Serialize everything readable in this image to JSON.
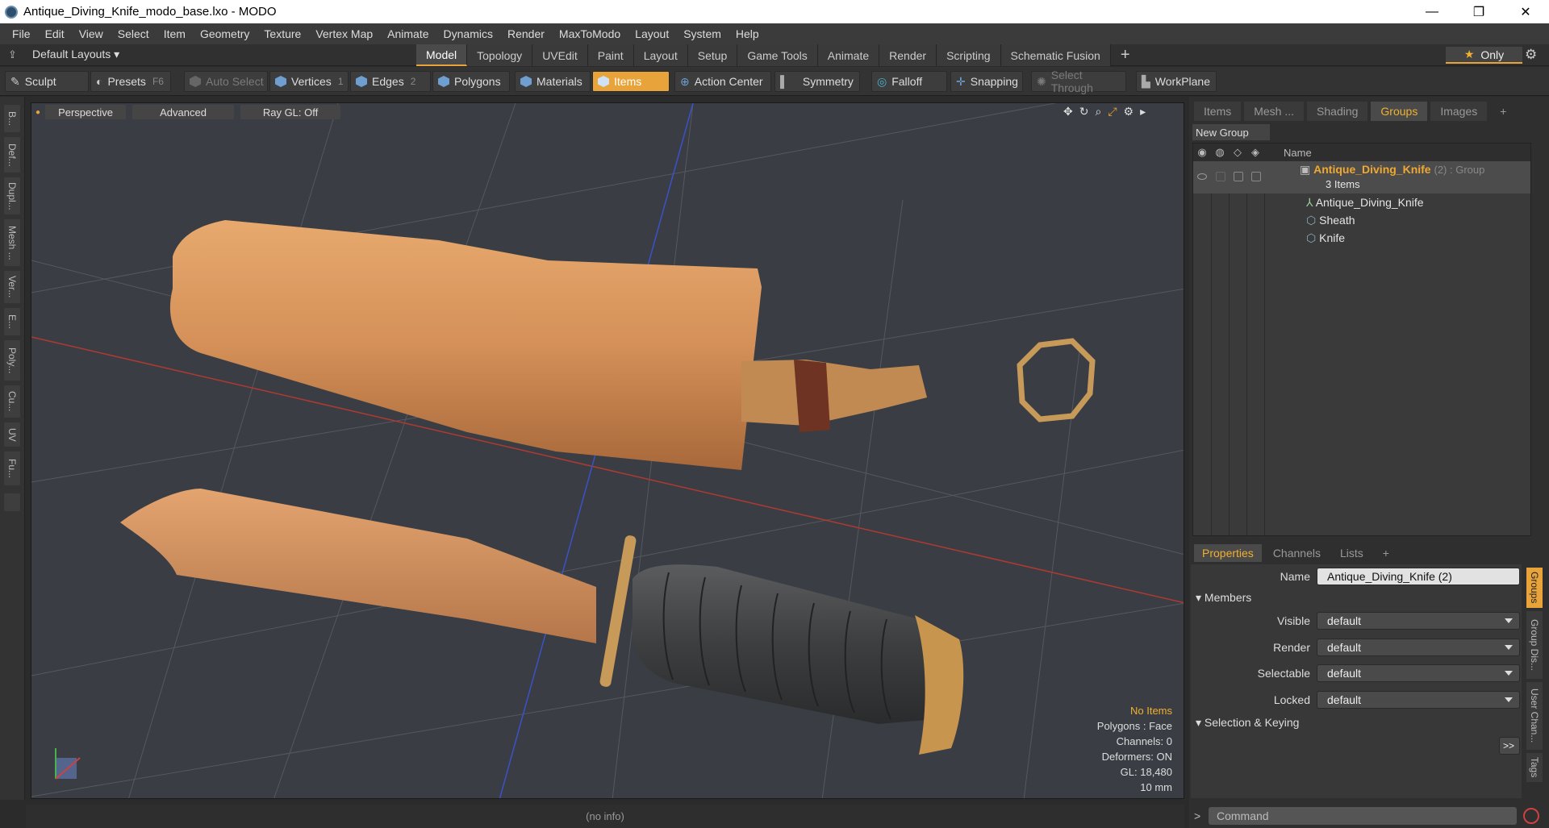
{
  "window": {
    "title": "Antique_Diving_Knife_modo_base.lxo - MODO",
    "minimize": "—",
    "restore": "❐",
    "close": "✕"
  },
  "menu": [
    "File",
    "Edit",
    "View",
    "Select",
    "Item",
    "Geometry",
    "Texture",
    "Vertex Map",
    "Animate",
    "Dynamics",
    "Render",
    "MaxToModo",
    "Layout",
    "System",
    "Help"
  ],
  "layout": {
    "default_layouts": "Default Layouts ▾",
    "tabs": [
      "Model",
      "Topology",
      "UVEdit",
      "Paint",
      "Layout",
      "Setup",
      "Game Tools",
      "Animate",
      "Render",
      "Scripting",
      "Schematic Fusion"
    ],
    "active_tab": "Model",
    "only": "Only"
  },
  "toolbar": {
    "sculpt": "Sculpt",
    "presets": "Presets",
    "presets_key": "F6",
    "auto_select": "Auto Select",
    "vertices": "Vertices",
    "vertices_count": "1",
    "edges": "Edges",
    "edges_count": "2",
    "polygons": "Polygons",
    "materials": "Materials",
    "items": "Items",
    "action_center": "Action Center",
    "symmetry": "Symmetry",
    "falloff": "Falloff",
    "snapping": "Snapping",
    "select_through": "Select Through",
    "workplane": "WorkPlane"
  },
  "left_tabs": [
    "B...",
    "Def...",
    "Dupl...",
    "Mesh ...",
    "Ver...",
    "E...",
    "Poly...",
    "Cu...",
    "UV",
    "Fu..."
  ],
  "viewport": {
    "perspective": "Perspective",
    "advanced": "Advanced",
    "raygl": "Ray GL: Off",
    "info": {
      "no_items": "No Items",
      "polygons": "Polygons : Face",
      "channels": "Channels: 0",
      "deformers": "Deformers: ON",
      "gl": "GL: 18,480",
      "units": "10 mm"
    }
  },
  "status": "(no info)",
  "right_tabs": [
    "Items",
    "Mesh ...",
    "Shading",
    "Groups",
    "Images"
  ],
  "right_active_tab": "Groups",
  "groups": {
    "new_group": "New Group",
    "col_name": "Name",
    "group_name": "Antique_Diving_Knife",
    "group_suffix": "(2) : Group",
    "group_count": "3 Items",
    "members": [
      "Antique_Diving_Knife",
      "Sheath",
      "Knife"
    ]
  },
  "props_tabs": [
    "Properties",
    "Channels",
    "Lists"
  ],
  "props": {
    "name_label": "Name",
    "name_value": "Antique_Diving_Knife (2)",
    "members_section": "Members",
    "fields": [
      {
        "label": "Visible",
        "value": "default"
      },
      {
        "label": "Render",
        "value": "default"
      },
      {
        "label": "Selectable",
        "value": "default"
      },
      {
        "label": "Locked",
        "value": "default"
      }
    ],
    "selection_section": "Selection & Keying",
    "more": ">>"
  },
  "side_vtabs": [
    "Groups",
    "Group Dis...",
    "User Chan...",
    "Tags"
  ],
  "command": {
    "prompt": ">",
    "placeholder": "Command"
  }
}
